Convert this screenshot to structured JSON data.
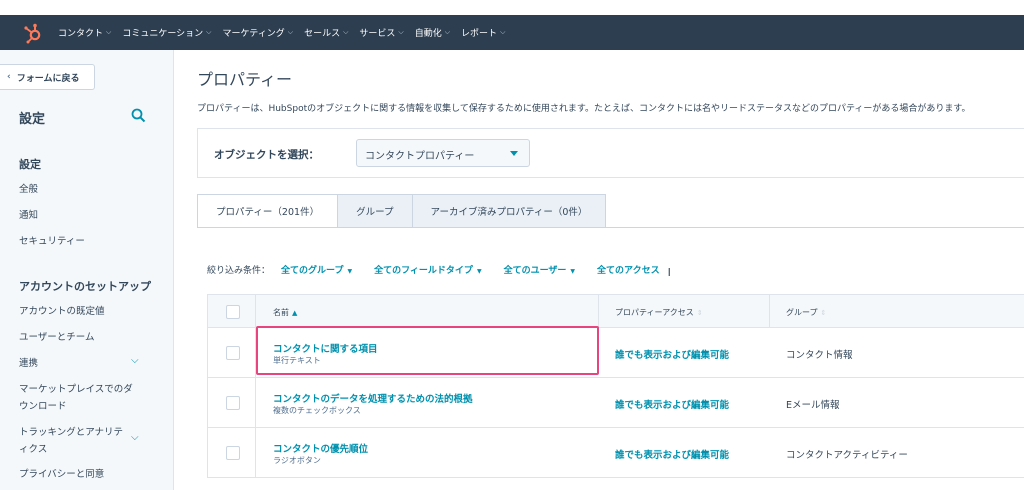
{
  "topnav": {
    "items": [
      "コンタクト",
      "コミュニケーション",
      "マーケティング",
      "セールス",
      "サービス",
      "自動化",
      "レポート"
    ],
    "colors": {
      "bar": "#2d3e50",
      "logo": "#ff7a59"
    }
  },
  "sidebar": {
    "back_label": "フォームに戻る",
    "title": "設定",
    "section_settings": "設定",
    "general": "全般",
    "notifications": "通知",
    "security": "セキュリティー",
    "section_account": "アカウントのセットアップ",
    "account_defaults": "アカウントの既定値",
    "users_teams": "ユーザーとチーム",
    "integrations": "連携",
    "marketplace_downloads": "マーケットプレイスでのダウンロード",
    "tracking_analytics": "トラッキングとアナリティクス",
    "privacy_consent": "プライバシーと同意"
  },
  "main": {
    "title": "プロパティー",
    "description": "プロパティーは、HubSpotのオブジェクトに関する情報を収集して保存するために使用されます。たとえば、コンタクトには名やリードステータスなどのプロパティーがある場合があります。",
    "object_label": "オブジェクトを選択：",
    "object_value": "コンタクトプロパティー",
    "tabs": [
      "プロパティー（201件）",
      "グループ",
      "アーカイブ済みプロパティー（0件）"
    ],
    "filters": {
      "label": "絞り込み条件：",
      "group": "全てのグループ",
      "field_type": "全てのフィールドタイプ",
      "user": "全てのユーザー",
      "access": "全てのアクセス"
    },
    "table": {
      "headers": {
        "name": "名前",
        "access": "プロパティーアクセス",
        "group": "グループ"
      },
      "rows": [
        {
          "name": "コンタクトに関する項目",
          "type": "単行テキスト",
          "access": "誰でも表示および編集可能",
          "group": "コンタクト情報"
        },
        {
          "name": "コンタクトのデータを処理するための法的根拠",
          "type": "複数のチェックボックス",
          "access": "誰でも表示および編集可能",
          "group": "Eメール情報"
        },
        {
          "name": "コンタクトの優先順位",
          "type": "ラジオボタン",
          "access": "誰でも表示および編集可能",
          "group": "コンタクトアクティビティー"
        }
      ]
    }
  },
  "colors": {
    "accent": "#0091ae",
    "highlight": "#e8457f"
  }
}
